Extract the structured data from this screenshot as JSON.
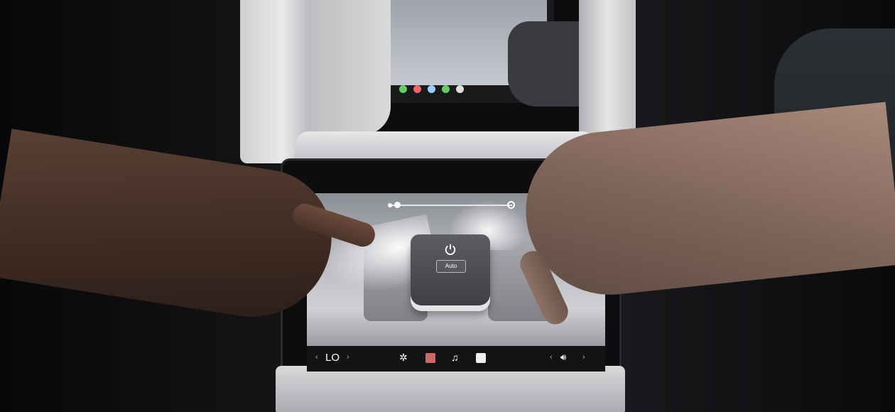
{
  "rear_screen": {
    "climate": {
      "auto_label": "Auto",
      "fan_slider_level": 0.05
    },
    "bottom_bar": {
      "temperature": "LO",
      "icons": [
        "fan-icon",
        "seat-heater-icon",
        "music-icon",
        "media-icon",
        "volume-icon"
      ]
    }
  },
  "colors": {
    "screen_bg": "#b7b9bf",
    "bar_bg": "#131316",
    "panel_bg": "#4b4d52",
    "heater_accent": "#cc6666"
  }
}
